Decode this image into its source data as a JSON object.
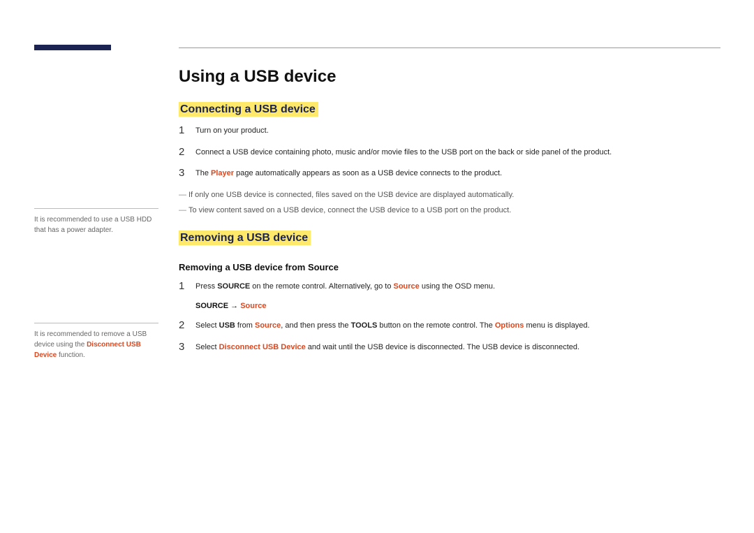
{
  "title": "Using a USB device",
  "sections": {
    "connecting": {
      "heading": "Connecting a USB device",
      "steps": [
        {
          "num": "1",
          "text_parts": [
            "Turn on your product."
          ]
        },
        {
          "num": "2",
          "text_parts": [
            "Connect a USB device containing photo, music and/or movie files to the USB port on the back or side panel of the product."
          ]
        },
        {
          "num": "3",
          "text_parts": [
            "The ",
            "Player",
            " page automatically appears as soon as a USB device connects to the product."
          ]
        }
      ],
      "notes": [
        "If only one USB device is connected, files saved on the USB device are displayed automatically.",
        "To view content saved on a USB device, connect the USB device to a USB port on the product."
      ]
    },
    "removing": {
      "heading": "Removing a USB device",
      "subheading": "Removing a USB device from Source",
      "path": {
        "pre": "SOURCE → ",
        "accent": "Source"
      },
      "steps": [
        {
          "num": "1",
          "parts": [
            {
              "t": "Press "
            },
            {
              "b": "SOURCE"
            },
            {
              "t": " on the remote control. Alternatively, go to "
            },
            {
              "a": "Source"
            },
            {
              "t": " using the OSD menu."
            }
          ]
        },
        {
          "num": "2",
          "parts": [
            {
              "t": "Select "
            },
            {
              "b": "USB"
            },
            {
              "t": " from "
            },
            {
              "a": "Source"
            },
            {
              "t": ", and then press the "
            },
            {
              "b": "TOOLS"
            },
            {
              "t": " button on the remote control. The "
            },
            {
              "a": "Options"
            },
            {
              "t": " menu is displayed."
            }
          ]
        },
        {
          "num": "3",
          "parts": [
            {
              "t": "Select "
            },
            {
              "a": "Disconnect USB Device"
            },
            {
              "t": " and wait until the USB device is disconnected. The USB device is disconnected."
            }
          ]
        }
      ]
    }
  },
  "sidebar": {
    "note1": "It is recommended to use a USB HDD that has a power adapter.",
    "note2_pre": "It is recommended to remove a USB device using the ",
    "note2_accent": "Disconnect USB Device",
    "note2_post": " function."
  }
}
